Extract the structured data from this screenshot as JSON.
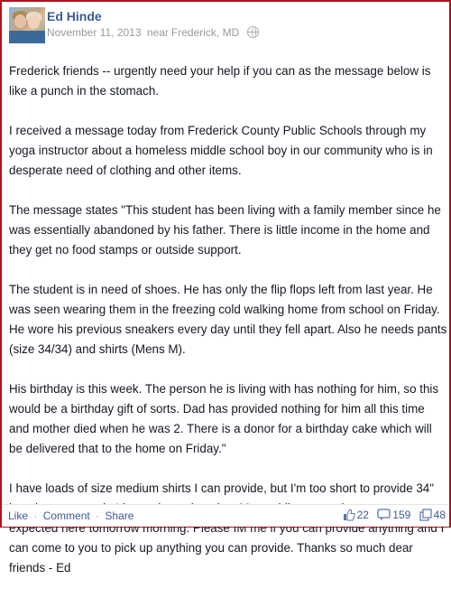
{
  "post": {
    "author": "Ed Hinde",
    "date": "November 11, 2013",
    "location_prefix": "near",
    "location": "Frederick, MD",
    "paragraphs": [
      "Frederick friends -- urgently need your help if you can as the message below is like a punch in the stomach.",
      "I received a message today from Frederick County Public Schools through my yoga instructor about a homeless middle school boy in our community who is in desperate need of clothing and other items.",
      "The message states \"This student has been living with a family member since he was essentially abandoned by his father. There is little income in the home and they get no food stamps or outside support.",
      "The student is in need of shoes. He has only the flip flops left from last year. He was seen wearing them in the freezing cold walking home from school on Friday. He wore his previous sneakers every day until they fell apart. Also he needs pants (size 34/34) and shirts (Mens M).",
      "His birthday is this week. The person he is living with has nothing for him, so this would be a birthday gift of sorts. Dad has provided nothing for him all this time and mother died when he was 2. There is a donor for a birthday cake which will be delivered that to the home on Friday.\"",
      "I have loads of size medium shirts I can provide, but I'm too short to provide 34\" length pants nor do I have shoes that size. Meanwhile, snow showers are expected here tomorrow morning. Please IM me if you can provide anything and I can come to you to pick up anything you can provide. Thanks so much dear friends - Ed"
    ]
  },
  "footer": {
    "like_label": "Like",
    "comment_label": "Comment",
    "share_label": "Share",
    "separator": "·",
    "likes_count": "22",
    "comments_count": "159",
    "shares_count": "48"
  },
  "icons": {
    "privacy": "globe-icon",
    "likes": "thumbs-up-icon",
    "comments": "comment-bubble-icon",
    "shares": "share-icon"
  },
  "colors": {
    "link": "#3b5998",
    "border": "#b1121a",
    "meta_text": "#999999"
  }
}
